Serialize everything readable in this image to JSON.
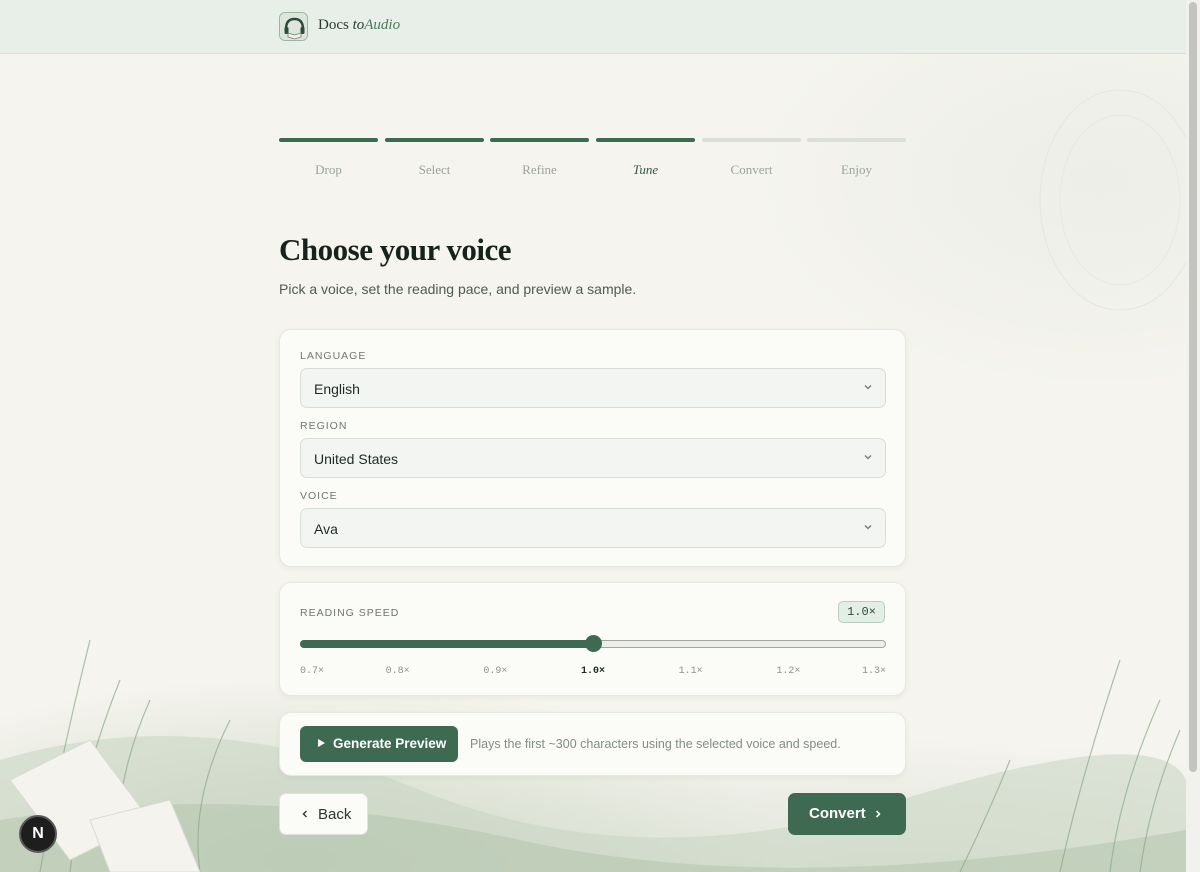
{
  "header": {
    "brand_part1": "Docs",
    "brand_part2": "to",
    "brand_part3": "Audio",
    "logo_icon": "headphones-book-icon"
  },
  "steps": [
    {
      "label": "Drop",
      "state": "done"
    },
    {
      "label": "Select",
      "state": "done"
    },
    {
      "label": "Refine",
      "state": "done"
    },
    {
      "label": "Tune",
      "state": "current"
    },
    {
      "label": "Convert",
      "state": "upcoming"
    },
    {
      "label": "Enjoy",
      "state": "upcoming"
    }
  ],
  "page": {
    "title": "Choose your voice",
    "subtitle": "Pick a voice, set the reading pace, and preview a sample."
  },
  "voice_settings": {
    "language_label": "LANGUAGE",
    "language_value": "English",
    "region_label": "REGION",
    "region_value": "United States",
    "voice_label": "VOICE",
    "voice_value": "Ava"
  },
  "speed": {
    "label": "READING SPEED",
    "badge": "1.0×",
    "value": 1.0,
    "min": 0.7,
    "max": 1.3,
    "ticks": [
      "0.7×",
      "0.8×",
      "0.9×",
      "1.0×",
      "1.1×",
      "1.2×",
      "1.3×"
    ],
    "active_tick": 3
  },
  "preview": {
    "button_label": "Generate Preview",
    "note": "Plays the first ~300 characters using the selected voice and speed."
  },
  "nav": {
    "back_label": "Back",
    "convert_label": "Convert"
  },
  "dev_badge": "N",
  "colors": {
    "accent": "#3f6a52",
    "header_bg": "#e7efe8",
    "page_bg": "#f5f4ee"
  }
}
